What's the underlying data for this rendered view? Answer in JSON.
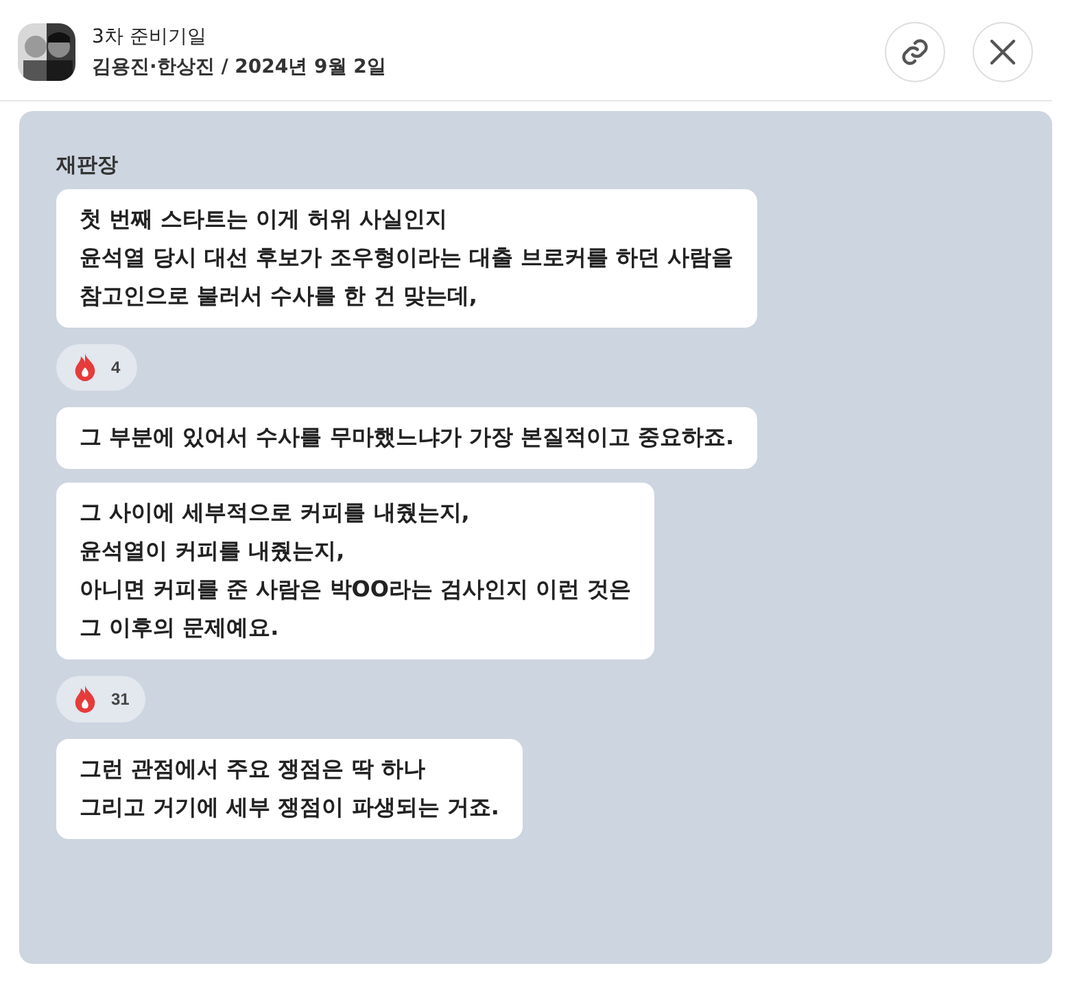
{
  "header": {
    "title": "3차 준비기일",
    "subtitle": "김용진·한상진 / 2024년 9월 2일"
  },
  "speaker": "재판장",
  "messages": [
    {
      "kind": "bubble",
      "lines": [
        "첫 번째 스타트는 이게 허위 사실인지",
        "윤석열 당시 대선 후보가 조우형이라는 대출 브로커를 하던 사람을",
        "참고인으로 불러서 수사를 한 건 맞는데,"
      ]
    },
    {
      "kind": "reaction",
      "count": "4"
    },
    {
      "kind": "bubble",
      "lines": [
        "그 부분에 있어서 수사를 무마했느냐가 가장 본질적이고 중요하죠."
      ]
    },
    {
      "kind": "bubble",
      "lines": [
        "그 사이에 세부적으로 커피를 내줬는지,",
        "윤석열이 커피를 내줬는지,",
        "아니면 커피를 준 사람은 박OO라는 검사인지 이런 것은",
        "그 이후의 문제예요."
      ]
    },
    {
      "kind": "reaction",
      "count": "31"
    },
    {
      "kind": "bubble",
      "lines": [
        "그런 관점에서 주요 쟁점은 딱 하나",
        "그리고 거기에 세부 쟁점이 파생되는 거죠."
      ]
    }
  ]
}
